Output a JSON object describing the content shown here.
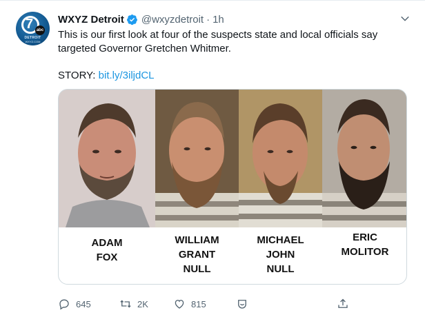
{
  "account": {
    "display_name": "WXYZ Detroit",
    "handle": "@wxyzdetroit",
    "separator": "·",
    "time": "1h",
    "avatar_text": {
      "number": "7",
      "network": "abc",
      "line1": "DETROIT",
      "line2": "WXYZ.COM"
    }
  },
  "tweet": {
    "text": "This is our first look at four of the suspects state and local officials say targeted Governor Gretchen Whitmer.",
    "story_prefix": "STORY: ",
    "story_link": "bit.ly/3iljdCL"
  },
  "media": {
    "suspects": [
      {
        "lines": [
          "ADAM",
          "FOX"
        ]
      },
      {
        "lines": [
          "WILLIAM",
          "GRANT",
          "NULL"
        ]
      },
      {
        "lines": [
          "MICHAEL",
          "JOHN",
          "NULL"
        ]
      },
      {
        "lines": [
          "ERIC",
          "MOLITOR"
        ]
      }
    ]
  },
  "actions": {
    "reply_count": "645",
    "retweet_count": "2K",
    "like_count": "815"
  },
  "colors": {
    "link": "#1b95e0",
    "verified": "#1d9bf0",
    "muted": "#536471"
  },
  "icons": [
    "verified-badge-icon",
    "chevron-down-icon",
    "reply-icon",
    "retweet-icon",
    "like-icon",
    "reaction-icon",
    "share-icon"
  ]
}
